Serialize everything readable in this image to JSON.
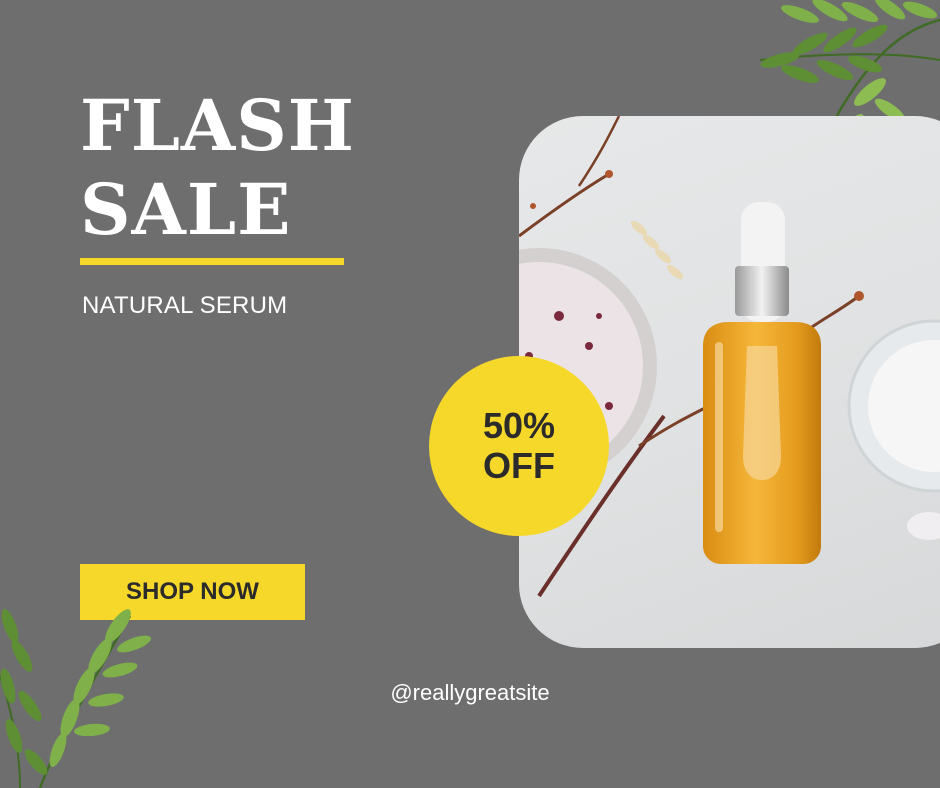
{
  "title": {
    "line1": "FLASH",
    "line2": "SALE"
  },
  "subtitle": "NATURAL SERUM",
  "badge": {
    "line1": "50%",
    "line2": "OFF"
  },
  "cta": {
    "label": "SHOP NOW"
  },
  "handle": "@reallygreatsite",
  "colors": {
    "background": "#6e6e6e",
    "accent": "#f5d82a",
    "text": "#ffffff",
    "dark_text": "#2b2b2b"
  },
  "images": {
    "product": "serum-bottle-photo",
    "decor": "green-leaf-sprigs"
  }
}
